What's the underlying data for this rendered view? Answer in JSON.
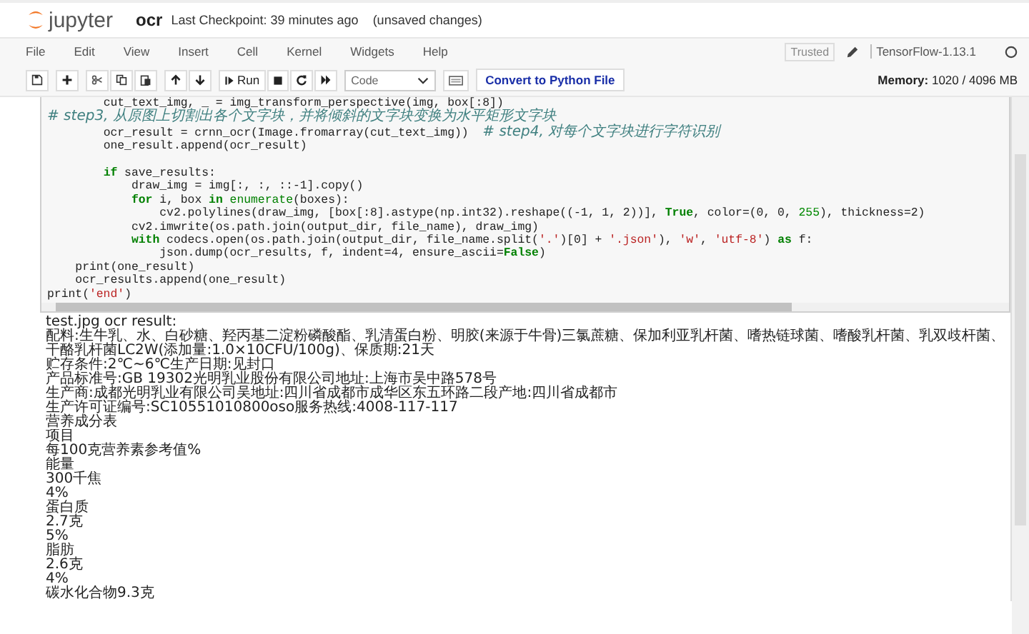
{
  "header": {
    "logo_text": "jupyter",
    "notebook_name": "ocr",
    "checkpoint": "Last Checkpoint: 39 minutes ago",
    "autosave": "(unsaved changes)"
  },
  "menubar": {
    "items": [
      "File",
      "Edit",
      "View",
      "Insert",
      "Cell",
      "Kernel",
      "Widgets",
      "Help"
    ],
    "trusted": "Trusted",
    "kernel_name": "TensorFlow-1.13.1",
    "kernel_busy": false
  },
  "toolbar": {
    "run_label": "Run",
    "cell_type": "Code",
    "convert_button": "Convert to Python File",
    "memory": "**Memory:** 1020 / 4096 MB"
  },
  "code_lines": [
    {
      "segments": [
        {
          "kind": "plain",
          "t": "        cut_text_img, _ = img_transform_perspective(img, box[:8])  "
        },
        {
          "kind": "comment",
          "t": "# step3, 从原图上切割出各个文字块，并将倾斜的文字块变换为水平矩形文字块"
        }
      ]
    },
    {
      "segments": [
        {
          "kind": "plain",
          "t": "        ocr_result = crnn_ocr(Image.fromarray(cut_text_img))  "
        },
        {
          "kind": "comment",
          "t": "# step4, 对每个文字块进行字符识别"
        }
      ]
    },
    {
      "segments": [
        {
          "kind": "plain",
          "t": "        one_result.append(ocr_result)"
        }
      ]
    },
    {
      "gap_before": true,
      "segments": [
        {
          "kind": "kw",
          "t": "        if"
        },
        {
          "kind": "plain",
          "t": " save_results:"
        }
      ]
    },
    {
      "segments": [
        {
          "kind": "plain",
          "t": "            draw_img = img[:, :, ::-1].copy()"
        }
      ]
    },
    {
      "segments": [
        {
          "kind": "kw",
          "t": "            for"
        },
        {
          "kind": "plain",
          "t": " i, box "
        },
        {
          "kind": "kw",
          "t": "in "
        },
        {
          "kind": "builtin",
          "t": "enumerate"
        },
        {
          "kind": "plain",
          "t": "(boxes):"
        }
      ]
    },
    {
      "segments": [
        {
          "kind": "plain",
          "t": "                cv2.polylines(draw_img, [box[:8].astype(np.int32).reshape((-1, 1, 2))], "
        },
        {
          "kind": "kw",
          "t": "True"
        },
        {
          "kind": "plain",
          "t": ", color=(0, 0, "
        },
        {
          "kind": "num",
          "t": "255"
        },
        {
          "kind": "plain",
          "t": "), thickness=2)"
        }
      ]
    },
    {
      "segments": [
        {
          "kind": "plain",
          "t": "            cv2.imwrite(os.path.join(output_dir, file_name), draw_img)"
        }
      ]
    },
    {
      "segments": [
        {
          "kind": "kw",
          "t": "            with"
        },
        {
          "kind": "plain",
          "t": " codecs.open(os.path.join(output_dir, file_name.split("
        },
        {
          "kind": "str",
          "t": "'.'"
        },
        {
          "kind": "plain",
          "t": ")[0] + "
        },
        {
          "kind": "str",
          "t": "'.json'"
        },
        {
          "kind": "plain",
          "t": "), "
        },
        {
          "kind": "str",
          "t": "'w'"
        },
        {
          "kind": "plain",
          "t": ", "
        },
        {
          "kind": "str",
          "t": "'utf-8'"
        },
        {
          "kind": "plain",
          "t": ") "
        },
        {
          "kind": "kw",
          "t": "as"
        },
        {
          "kind": "plain",
          "t": " f:"
        }
      ]
    },
    {
      "segments": [
        {
          "kind": "plain",
          "t": "                json.dump(ocr_results, f, indent=4, ensure_ascii="
        },
        {
          "kind": "kw",
          "t": "False"
        },
        {
          "kind": "plain",
          "t": ")"
        }
      ]
    },
    {
      "segments": [
        {
          "kind": "plain",
          "t": "    print(one_result)"
        }
      ]
    },
    {
      "segments": [
        {
          "kind": "plain",
          "t": "    ocr_results.append(one_result)"
        }
      ]
    },
    {
      "segments": [
        {
          "kind": "plain",
          "t": "print("
        },
        {
          "kind": "str",
          "t": "'end'"
        },
        {
          "kind": "plain",
          "t": ")"
        }
      ]
    }
  ],
  "output_lines": [
    "test.jpg ocr result:",
    "配料:生牛乳、水、白砂糖、羟丙基二淀粉磷酸酯、乳清蛋白粉、明胶(来源于牛骨)三氯蔗糖、保加利亚乳杆菌、嗜热链球菌、嗜酸乳杆菌、乳双歧杆菌、",
    "干酪乳杆菌LC2W(添加量:1.0×10CFU/100g)、保质期:21天",
    "贮存条件:2℃~6℃生产日期:见封口",
    "产品标准号:GB 19302光明乳业股份有限公司地址:上海市吴中路578号",
    "生产商:成都光明乳业有限公司吴地址:四川省成都市成华区东五环路二段产地:四川省成都市",
    "生产许可证编号:SC10551010800oso服务热线:4008-117-117",
    "营养成分表",
    "项目",
    "每100克营养素参考值%",
    "能量",
    "300千焦",
    "4%",
    "蛋白质",
    "2.7克",
    "5%",
    "脂肪",
    "2.6克",
    "4%",
    "碳水化合物9.3克"
  ]
}
